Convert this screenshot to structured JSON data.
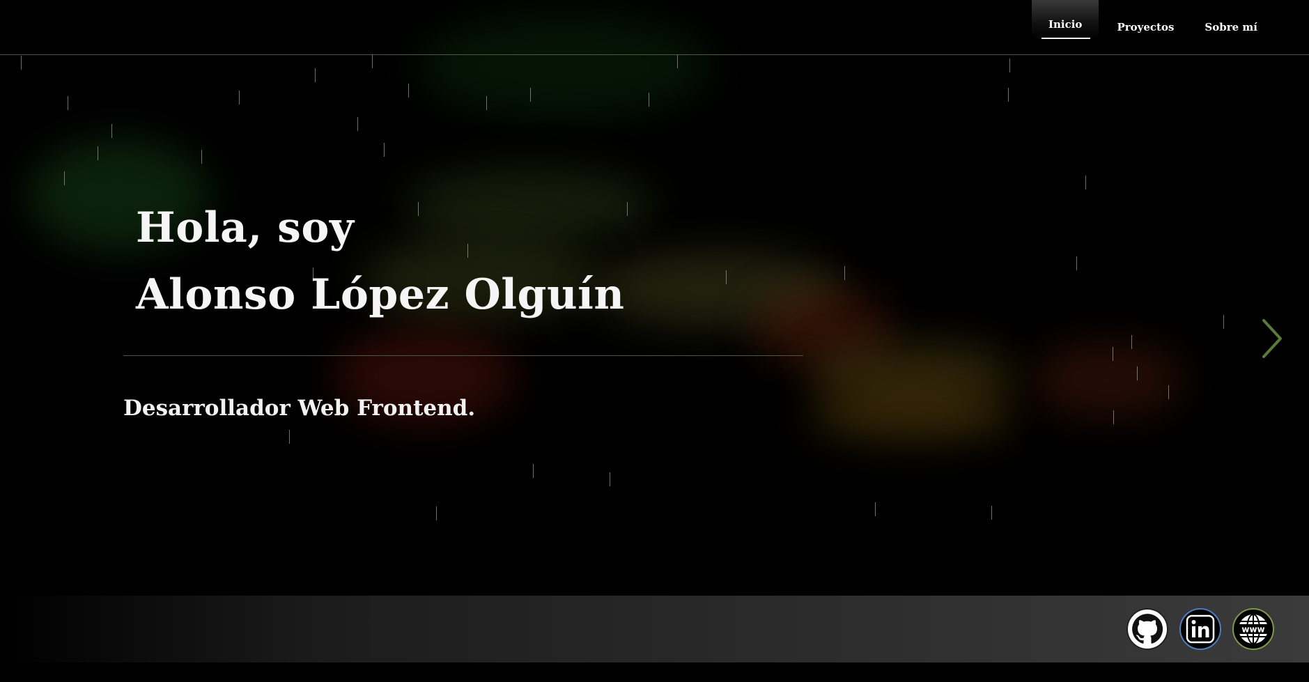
{
  "nav": {
    "items": [
      {
        "label": "Inicio",
        "active": true
      },
      {
        "label": "Proyectos",
        "active": false
      },
      {
        "label": "Sobre mí",
        "active": false
      }
    ]
  },
  "hero": {
    "greeting": "Hola, soy",
    "name": "Alonso López Olguín",
    "role": "Desarrollador Web Frontend."
  },
  "carousel": {
    "next_icon": "chevron-right-icon",
    "accent_color": "#5b7a3a"
  },
  "social": {
    "items": [
      {
        "name": "github",
        "icon": "github-icon",
        "color": "#ffffff"
      },
      {
        "name": "linkedin",
        "icon": "linkedin-icon",
        "color": "#4a7fc0"
      },
      {
        "name": "website",
        "icon": "globe-www-icon",
        "color": "#7c9a4a"
      }
    ]
  },
  "colors": {
    "background": "#000000",
    "divider": "#4d5a42",
    "text": "#f2f2f2"
  }
}
